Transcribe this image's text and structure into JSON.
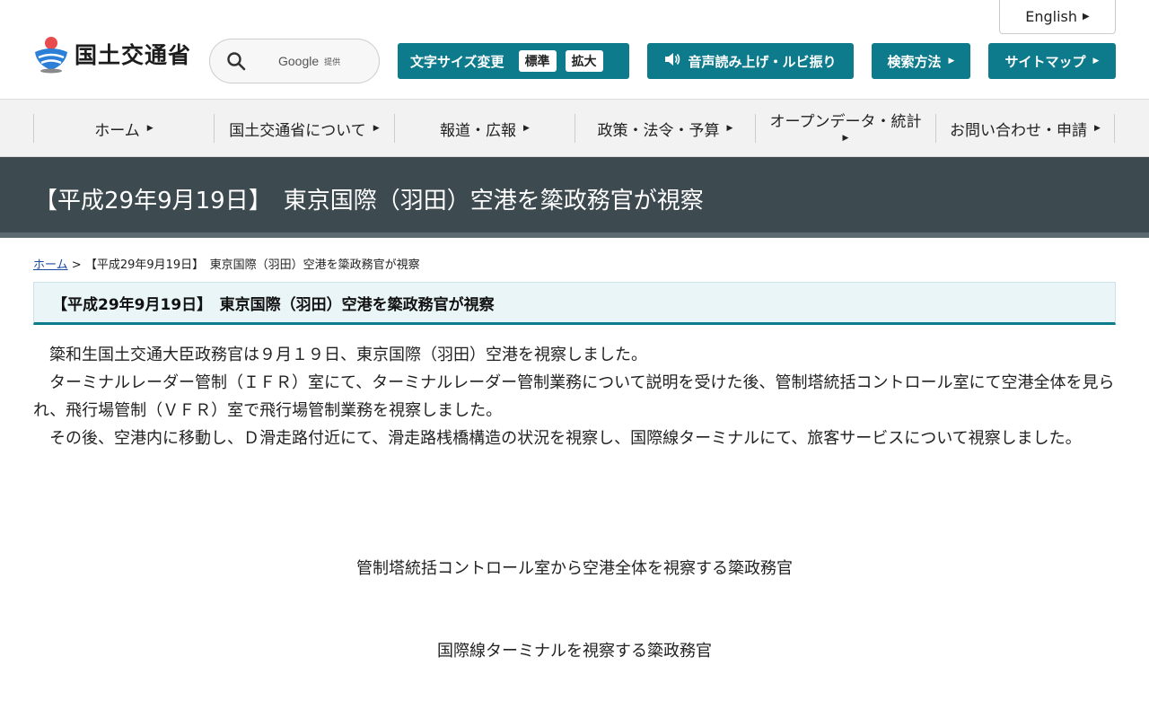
{
  "header": {
    "english_label": "English",
    "logo_text": "国土交通省",
    "search": {
      "google_label": "Google",
      "provided_label": "提供"
    },
    "font_size": {
      "label": "文字サイズ変更",
      "standard": "標準",
      "large": "拡大"
    },
    "voice_label": "音声読み上げ・ルビ振り",
    "search_method_label": "検索方法",
    "sitemap_label": "サイトマップ"
  },
  "nav": {
    "items": [
      {
        "label": "ホーム"
      },
      {
        "label": "国土交通省について"
      },
      {
        "label": "報道・広報"
      },
      {
        "label": "政策・法令・予算"
      },
      {
        "label": "オープンデータ・統計"
      },
      {
        "label": "お問い合わせ・申請"
      }
    ]
  },
  "page": {
    "title": "【平成29年9月19日】　東京国際（羽田）空港を簗政務官が視察",
    "breadcrumb": {
      "home": "ホーム",
      "separator": ">",
      "current": "【平成29年9月19日】　東京国際（羽田）空港を簗政務官が視察"
    },
    "section_heading": "【平成29年9月19日】　東京国際（羽田）空港を簗政務官が視察",
    "paragraphs": [
      "簗和生国土交通大臣政務官は９月１９日、東京国際（羽田）空港を視察しました。",
      "ターミナルレーダー管制（ＩＦＲ）室にて、ターミナルレーダー管制業務について説明を受けた後、管制塔統括コントロール室にて空港全体を見られ、飛行場管制（ＶＦＲ）室で飛行場管制業務を視察しました。",
      "その後、空港内に移動し、Ｄ滑走路付近にて、滑走路桟橋構造の状況を視察し、国際線ターミナルにて、旅客サービスについて視察しました。"
    ],
    "captions": [
      "管制塔統括コントロール室から空港全体を視察する簗政務官",
      "国際線ターミナルを視察する簗政務官"
    ]
  },
  "colors": {
    "accent": "#0e7b8c",
    "title_band": "#3d4a50",
    "nav_bg": "#f2f2f2"
  }
}
